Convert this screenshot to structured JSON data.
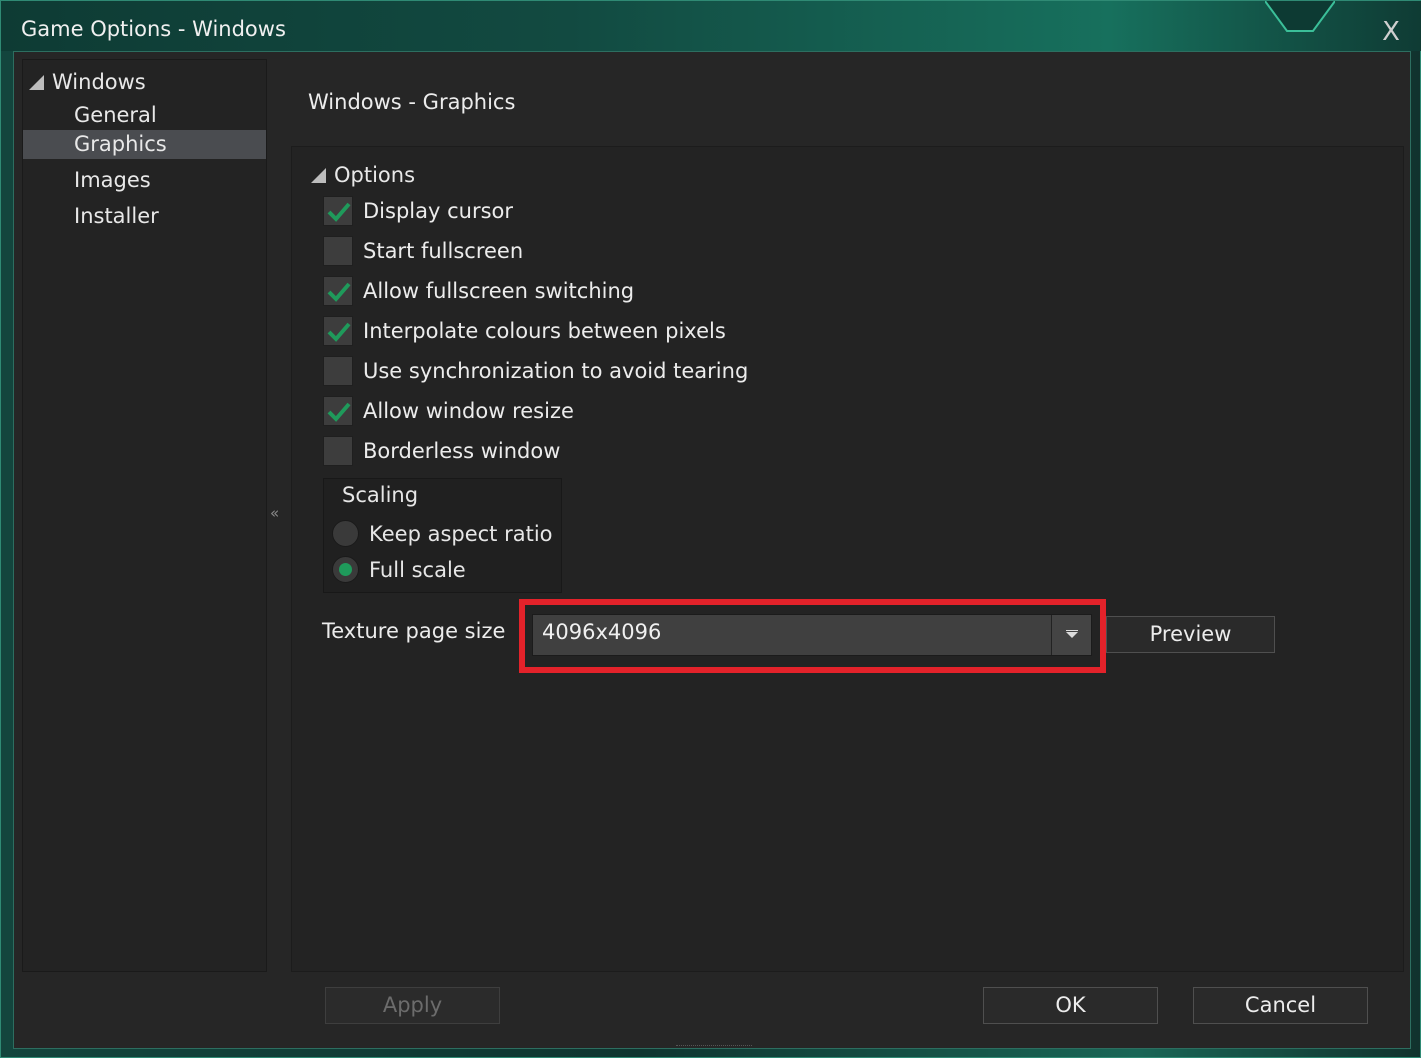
{
  "window": {
    "title": "Game Options - Windows",
    "close_glyph": "X"
  },
  "tree": {
    "root": {
      "label": "Windows",
      "icon": "expanded-triangle-icon"
    },
    "items": [
      {
        "label": "General",
        "selected": false
      },
      {
        "label": "Graphics",
        "selected": true
      },
      {
        "label": "Images",
        "selected": false
      },
      {
        "label": "Installer",
        "selected": false
      }
    ]
  },
  "collapse_glyph": "«",
  "page": {
    "title": "Windows - Graphics"
  },
  "options": {
    "header": "Options",
    "checkboxes": [
      {
        "label": "Display cursor",
        "checked": true
      },
      {
        "label": "Start fullscreen",
        "checked": false
      },
      {
        "label": "Allow fullscreen switching",
        "checked": true
      },
      {
        "label": "Interpolate colours between pixels",
        "checked": true
      },
      {
        "label": "Use synchronization to avoid tearing",
        "checked": false
      },
      {
        "label": "Allow window resize",
        "checked": true
      },
      {
        "label": "Borderless window",
        "checked": false
      }
    ],
    "scaling": {
      "title": "Scaling",
      "options": [
        {
          "label": "Keep aspect ratio",
          "selected": false
        },
        {
          "label": "Full scale",
          "selected": true
        }
      ]
    },
    "texture": {
      "label": "Texture page size",
      "value": "4096x4096",
      "preview_label": "Preview"
    }
  },
  "footer": {
    "apply": "Apply",
    "ok": "OK",
    "cancel": "Cancel"
  },
  "colors": {
    "accent": "#1f9a5b",
    "highlight": "#e3222a",
    "selection": "#4a4c50"
  }
}
